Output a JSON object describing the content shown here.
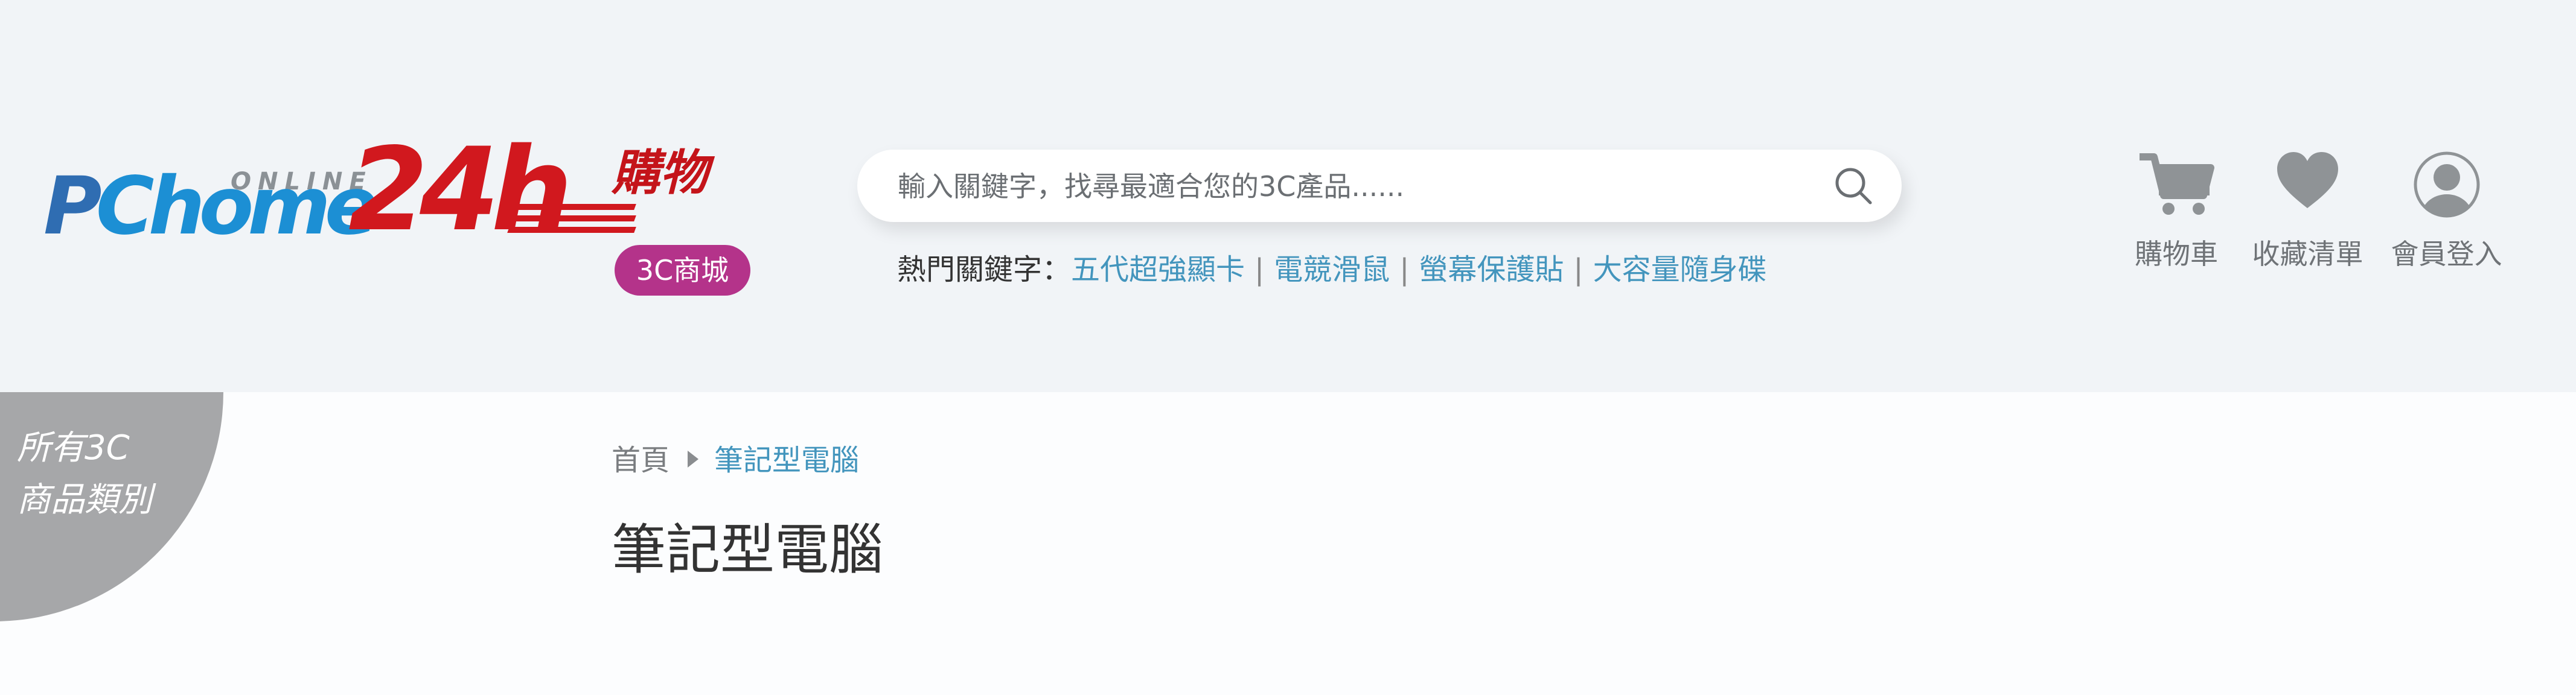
{
  "logo": {
    "online": "ONLINE",
    "pc_part1": "P",
    "pc_part2": "Chome",
    "number": "24h",
    "shopping": "購物",
    "badge": "3C商城"
  },
  "search": {
    "placeholder": "輸入關鍵字，找尋最適合您的3C產品......",
    "icon": "search-icon"
  },
  "hot_keywords": {
    "label": "熱門關鍵字：",
    "items": [
      "五代超強顯卡",
      "電競滑鼠",
      "螢幕保護貼",
      "大容量隨身碟"
    ],
    "separator": "|"
  },
  "nav": {
    "cart": {
      "label": "購物車",
      "icon": "cart-icon"
    },
    "favorites": {
      "label": "收藏清單",
      "icon": "heart-icon"
    },
    "login": {
      "label": "會員登入",
      "icon": "user-icon"
    }
  },
  "categories_tab": {
    "line1": "所有3C",
    "line2": "商品類別"
  },
  "breadcrumb": {
    "home": "首頁",
    "current": "筆記型電腦"
  },
  "page_title": "筆記型電腦",
  "colors": {
    "header_bg": "#f1f4f7",
    "brand_red": "#d1181e",
    "brand_blue": "#2f6db2",
    "badge_magenta": "#b4338a",
    "link_blue": "#4395bd",
    "icon_gray": "#8f9396"
  }
}
